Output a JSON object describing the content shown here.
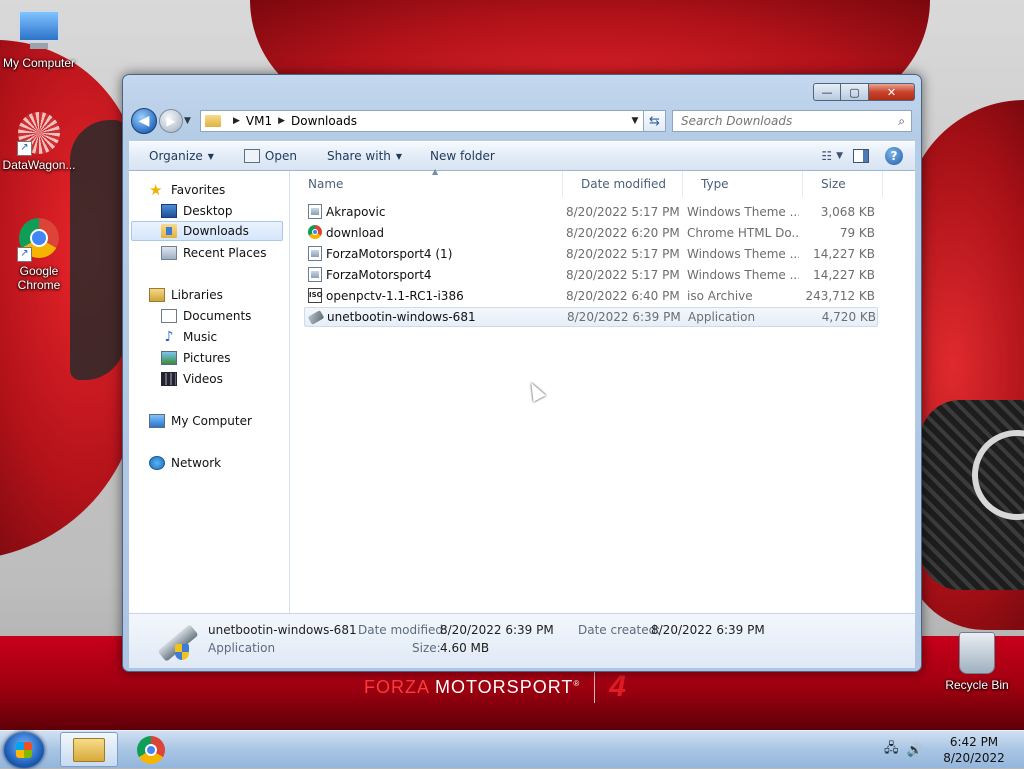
{
  "desktop": {
    "icons": [
      {
        "label": "My Computer"
      },
      {
        "label": "DataWagon..."
      },
      {
        "label": "Google Chrome"
      },
      {
        "label": "Recycle Bin"
      }
    ],
    "wallpaper_brand": {
      "part1": "FORZA",
      "part2": " MOTORSPORT",
      "reg": "®",
      "mark": "4"
    }
  },
  "window": {
    "caption_buttons": {
      "minimize": "—",
      "maximize": "▢",
      "close": "✕"
    },
    "address": {
      "crumbs": [
        "VM1",
        "Downloads"
      ]
    },
    "search": {
      "placeholder": "Search Downloads"
    },
    "toolbar": {
      "organize": "Organize",
      "open": "Open",
      "share_with": "Share with",
      "new_folder": "New folder"
    },
    "nav_pane": {
      "favorites": "Favorites",
      "desktop": "Desktop",
      "downloads": "Downloads",
      "recent_places": "Recent Places",
      "libraries": "Libraries",
      "documents": "Documents",
      "music": "Music",
      "pictures": "Pictures",
      "videos": "Videos",
      "my_computer": "My Computer",
      "network": "Network"
    },
    "columns": {
      "name": "Name",
      "date": "Date modified",
      "type": "Type",
      "size": "Size"
    },
    "files": [
      {
        "name": "Akrapovic",
        "date": "8/20/2022 5:17 PM",
        "type": "Windows Theme ...",
        "size": "3,068 KB",
        "icon": "theme-file-icon"
      },
      {
        "name": "download",
        "date": "8/20/2022 6:20 PM",
        "type": "Chrome HTML Do...",
        "size": "79 KB",
        "icon": "chrome-file-icon"
      },
      {
        "name": "ForzaMotorsport4 (1)",
        "date": "8/20/2022 5:17 PM",
        "type": "Windows Theme ...",
        "size": "14,227 KB",
        "icon": "theme-file-icon"
      },
      {
        "name": "ForzaMotorsport4",
        "date": "8/20/2022 5:17 PM",
        "type": "Windows Theme ...",
        "size": "14,227 KB",
        "icon": "theme-file-icon"
      },
      {
        "name": "openpctv-1.1-RC1-i386",
        "date": "8/20/2022 6:40 PM",
        "type": "iso Archive",
        "size": "243,712 KB",
        "icon": "iso-file-icon"
      },
      {
        "name": "unetbootin-windows-681",
        "date": "8/20/2022 6:39 PM",
        "type": "Application",
        "size": "4,720 KB",
        "icon": "application-file-icon"
      }
    ],
    "details": {
      "name": "unetbootin-windows-681",
      "type": "Application",
      "date_modified_label": "Date modified:",
      "date_modified": "8/20/2022 6:39 PM",
      "date_created_label": "Date created:",
      "date_created": "8/20/2022 6:39 PM",
      "size_label": "Size:",
      "size": "4.60 MB"
    }
  },
  "taskbar": {
    "clock_time": "6:42 PM",
    "clock_date": "8/20/2022"
  }
}
